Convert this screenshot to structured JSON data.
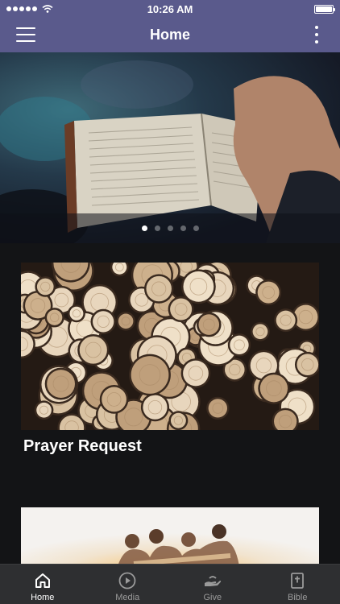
{
  "status_bar": {
    "time": "10:26 AM",
    "signal_bars": 5
  },
  "header": {
    "title": "Home",
    "menu_icon": "hamburger-menu-icon",
    "more_icon": "more-vertical-icon"
  },
  "hero": {
    "image": "open-bible-reading",
    "slides": 5,
    "active_slide": 1
  },
  "cards": [
    {
      "title": "Prayer Request",
      "image": "stacked-cut-logs"
    },
    {
      "title": "",
      "image": "people-embracing-sunset"
    }
  ],
  "tabs": [
    {
      "label": "Home",
      "icon": "home-icon",
      "active": true
    },
    {
      "label": "Media",
      "icon": "play-circle-icon",
      "active": false
    },
    {
      "label": "Give",
      "icon": "giving-hands-icon",
      "active": false
    },
    {
      "label": "Bible",
      "icon": "bible-icon",
      "active": false
    }
  ],
  "colors": {
    "header_bg": "#5a5a8c",
    "page_bg": "#131416",
    "tab_bar_bg": "#2e2f31",
    "tab_active": "#ffffff",
    "tab_inactive": "#9a9a9a"
  }
}
